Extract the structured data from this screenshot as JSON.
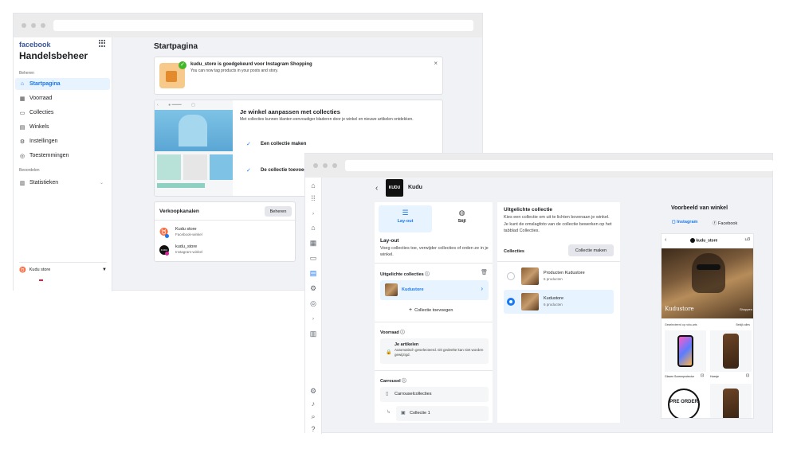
{
  "w1": {
    "brand": "facebook",
    "app_title": "Handelsbeheer",
    "section_manage": "Beheren",
    "nav": [
      "Startpagina",
      "Voorraad",
      "Collecties",
      "Winkels",
      "Instellingen",
      "Toestemmingen"
    ],
    "section_insights": "Beoordelen",
    "insights_item": "Statistieken",
    "store_switch": "Kudu store",
    "page_title": "Startpagina",
    "notice": {
      "title": "kudu_store is goedgekeurd voor Instagram Shopping",
      "body": "You can now tag products in your posts and story."
    },
    "promo": {
      "title": "Je winkel aanpassen met collecties",
      "body": "Met collecties kunnen klanten eenvoudiger bladeren door je winkel en nieuwe artikelen ontdekken.",
      "step1": "Een collectie maken",
      "step2": "De collectie toevoegen"
    },
    "channels": {
      "title": "Verkoopkanalen",
      "manage": "Beheren",
      "items": [
        {
          "name": "Kudu store",
          "sub": "Facebook-winkel"
        },
        {
          "name": "kudu_store",
          "sub": "Instagram-winkel"
        }
      ]
    }
  },
  "w2": {
    "store_logo": "KUDU",
    "store_name": "Kudu",
    "tabs": [
      "Lay-out",
      "Stijl"
    ],
    "layout": {
      "title": "Lay-out",
      "desc": "Voeg collecties toe, verwijder collecties of orden ze in je winkel.",
      "featured_label": "Uitgelichte collecties",
      "featured_item": "Kudustore",
      "add_collection": "Collectie toevoegen",
      "stock_label": "Voorraad",
      "stock_title": "Je artikelen",
      "stock_desc": "Automatisch geselecteerd. Dit gedeelte kan niet worden gewijzigd.",
      "carousel_label": "Carrousel",
      "carousel_title": "Carrouselcollecties",
      "carousel_item": "Collectie 1"
    },
    "featured_panel": {
      "title": "Uitgelichte collectie",
      "desc": "Kies een collectie om uit te lichten bovenaan je winkel. Je kunt de omslagfoto van de collectie bewerken op het tabblad Collecties.",
      "collections_label": "Collecties",
      "make_button": "Collectie maken",
      "items": [
        {
          "name": "Producten Kudustore",
          "count": "6 producten"
        },
        {
          "name": "Kudustore",
          "count": "6 producten"
        }
      ]
    },
    "preview": {
      "title": "Voorbeeld van winkel",
      "tab_instagram": "Instagram",
      "tab_facebook": "Facebook",
      "handle": "kudu_store",
      "bag_count": "3",
      "hero_text": "Kudustore",
      "hero_cta": "Shoppen",
      "section_left": "Geselecteerd op robo-arts",
      "section_right": "Bekijk alles",
      "product1": "Glazen Screenprotector",
      "product2": "Hoesje",
      "preorder": "PRE ORDER"
    },
    "accent": "#1877f2"
  }
}
